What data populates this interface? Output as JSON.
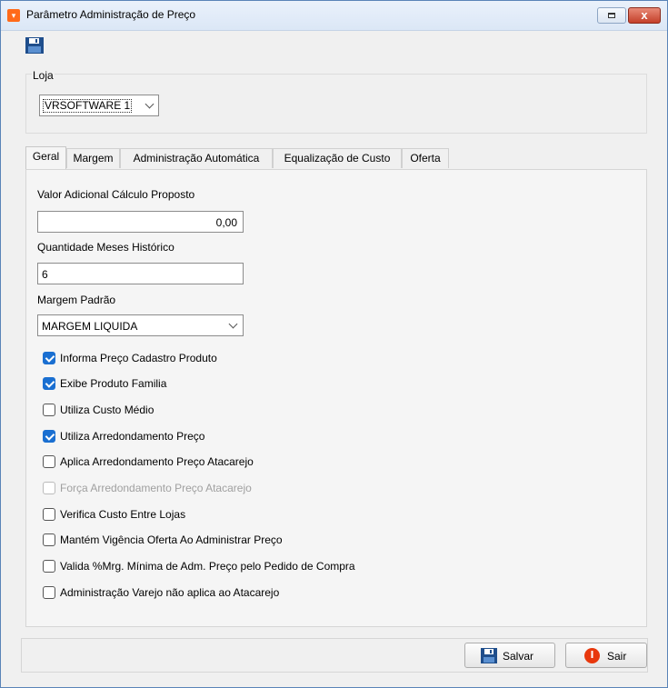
{
  "window": {
    "title": "Parâmetro Administração de Preço",
    "close_glyph": "x",
    "icons": {
      "app": "app-logo-icon",
      "restore": "restore-icon",
      "close": "close-icon",
      "save": "floppy-disk-icon"
    }
  },
  "loja": {
    "label": "Loja",
    "selected": "VRSOFTWARE 1"
  },
  "tabs": [
    {
      "label": "Geral",
      "active": true
    },
    {
      "label": "Margem",
      "active": false
    },
    {
      "label": "Administração Automática",
      "active": false
    },
    {
      "label": "Equalização de Custo",
      "active": false
    },
    {
      "label": "Oferta",
      "active": false
    }
  ],
  "geral": {
    "valor_adicional": {
      "label": "Valor Adicional Cálculo Proposto",
      "value": "0,00"
    },
    "quantidade_meses": {
      "label": "Quantidade Meses Histórico",
      "value": "6"
    },
    "margem_padrao": {
      "label": "Margem Padrão",
      "selected": "MARGEM LIQUIDA"
    },
    "checkboxes": [
      {
        "label": "Informa Preço Cadastro Produto",
        "checked": true,
        "enabled": true
      },
      {
        "label": "Exibe Produto Familia",
        "checked": true,
        "enabled": true
      },
      {
        "label": "Utiliza Custo Médio",
        "checked": false,
        "enabled": true
      },
      {
        "label": "Utiliza Arredondamento Preço",
        "checked": true,
        "enabled": true
      },
      {
        "label": "Aplica Arredondamento Preço Atacarejo",
        "checked": false,
        "enabled": true
      },
      {
        "label": "Força Arredondamento Preço Atacarejo",
        "checked": false,
        "enabled": false
      },
      {
        "label": "Verifica Custo Entre Lojas",
        "checked": false,
        "enabled": true
      },
      {
        "label": "Mantém Vigência Oferta Ao Administrar Preço",
        "checked": false,
        "enabled": true
      },
      {
        "label": "Valida %Mrg. Mínima de Adm. Preço pelo Pedido de Compra",
        "checked": false,
        "enabled": true
      },
      {
        "label": "Administração Varejo não aplica ao Atacarejo",
        "checked": false,
        "enabled": true
      }
    ]
  },
  "footer": {
    "save_label": "Salvar",
    "exit_label": "Sair"
  },
  "colors": {
    "accent": "#1a6fd1",
    "close": "#c4402a",
    "exit_icon": "#e8380d",
    "save_icon": "#1f4e8c"
  }
}
